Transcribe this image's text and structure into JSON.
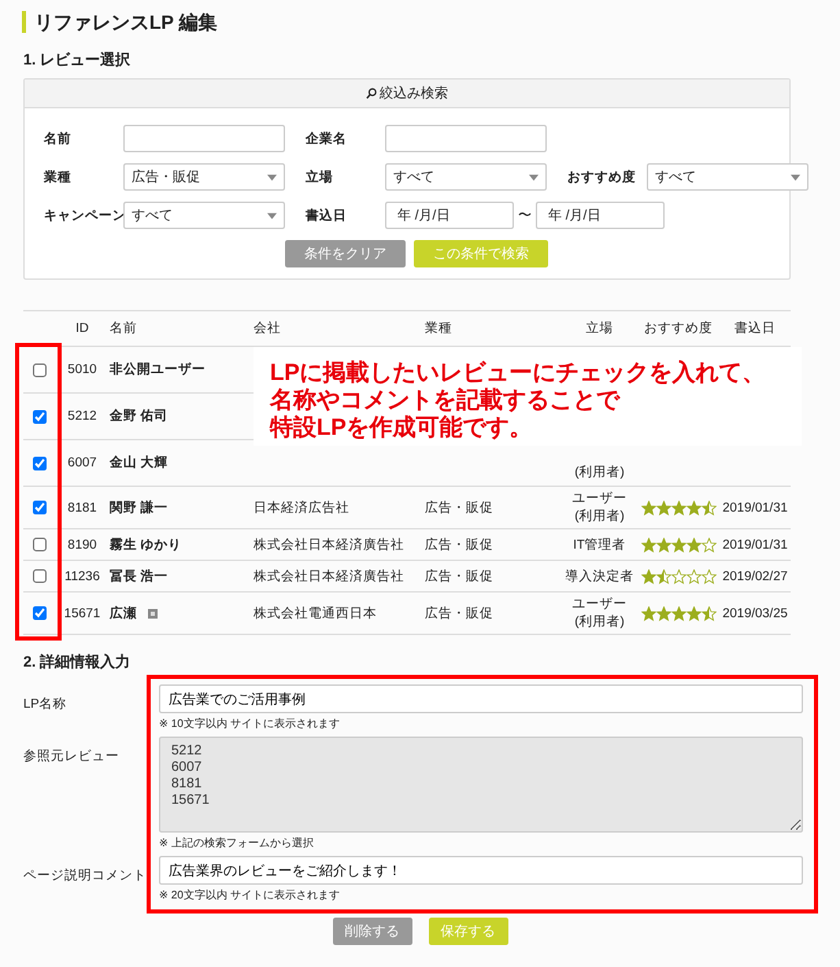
{
  "page_title": "リファレンスLP 編集",
  "review_selection": {
    "heading": "1. レビュー選択",
    "search_panel": {
      "title": "絞込み検索",
      "rows": [
        [
          {
            "kind": "text",
            "label": "名前"
          },
          {
            "kind": "text",
            "label": "企業名"
          }
        ],
        [
          {
            "kind": "select",
            "label": "業種",
            "value": "広告・販促"
          },
          {
            "kind": "select",
            "label": "立場",
            "value": "すべて"
          },
          {
            "kind": "select",
            "label": "おすすめ度",
            "value": "すべて"
          }
        ],
        [
          {
            "kind": "select",
            "label": "キャンペーン",
            "value": "すべて"
          },
          {
            "kind": "date_range",
            "label": "書込日",
            "from": "年 /月/日",
            "separator": "〜",
            "to": "年 /月/日"
          }
        ]
      ],
      "buttons": [
        {
          "label": "条件をクリア",
          "kind": "secondary"
        },
        {
          "label": "この条件で検索",
          "kind": "primary"
        }
      ]
    },
    "table": {
      "columns": [
        "ID",
        "名前",
        "会社",
        "業種",
        "立場",
        "おすすめ度",
        "書込日"
      ],
      "rows": [
        {
          "checked": false,
          "id": "5010",
          "name": "非公開ユーザー",
          "badge": false
        },
        {
          "checked": true,
          "id": "5212",
          "name": "金野 佑司",
          "badge": false
        },
        {
          "checked": true,
          "id": "6007",
          "name": "金山 大輝",
          "position": "(利用者)",
          "badge": false
        },
        {
          "checked": true,
          "id": "8181",
          "name": "関野 謙一",
          "company": "日本経済広告社",
          "industry": "広告・販促",
          "position": "ユーザー\n(利用者)",
          "stars": 4.5,
          "date": "2019/01/31",
          "badge": false
        },
        {
          "checked": false,
          "id": "8190",
          "name": "霧生 ゆかり",
          "company": "株式会社日本経済廣告社",
          "industry": "広告・販促",
          "position": "IT管理者",
          "stars": 4,
          "date": "2019/01/31",
          "badge": false
        },
        {
          "checked": false,
          "id": "11236",
          "name": "冨長 浩一",
          "company": "株式会社日本経済廣告社",
          "industry": "広告・販促",
          "position": "導入決定者",
          "stars": 1.5,
          "date": "2019/02/27",
          "badge": false
        },
        {
          "checked": true,
          "id": "15671",
          "name": "広瀬",
          "company": "株式会社電通西日本",
          "industry": "広告・販促",
          "position": "ユーザー\n(利用者)",
          "stars": 4.5,
          "date": "2019/03/25",
          "badge": true
        }
      ]
    },
    "callout_lines": [
      "LPに掲載したいレビューにチェックを入れて、",
      "名称やコメントを記載することで",
      "特設LPを作成可能です。"
    ]
  },
  "detail_input": {
    "heading": "2. 詳細情報入力",
    "fields": [
      {
        "kind": "input",
        "label": "LP名称",
        "value": "広告業でのご活用事例",
        "note": "※ 10文字以内 サイトに表示されます",
        "disabled": false
      },
      {
        "kind": "textarea",
        "label": "参照元レビュー",
        "value": "5212\n6007\n8181\n15671",
        "note": "※ 上記の検索フォームから選択",
        "disabled": true
      },
      {
        "kind": "input",
        "label": "ページ説明コメント",
        "value": "広告業界のレビューをご紹介します！",
        "note": "※ 20文字以内 サイトに表示されます",
        "disabled": false
      }
    ],
    "buttons": [
      {
        "label": "削除する",
        "kind": "secondary"
      },
      {
        "label": "保存する",
        "kind": "primary"
      }
    ]
  }
}
